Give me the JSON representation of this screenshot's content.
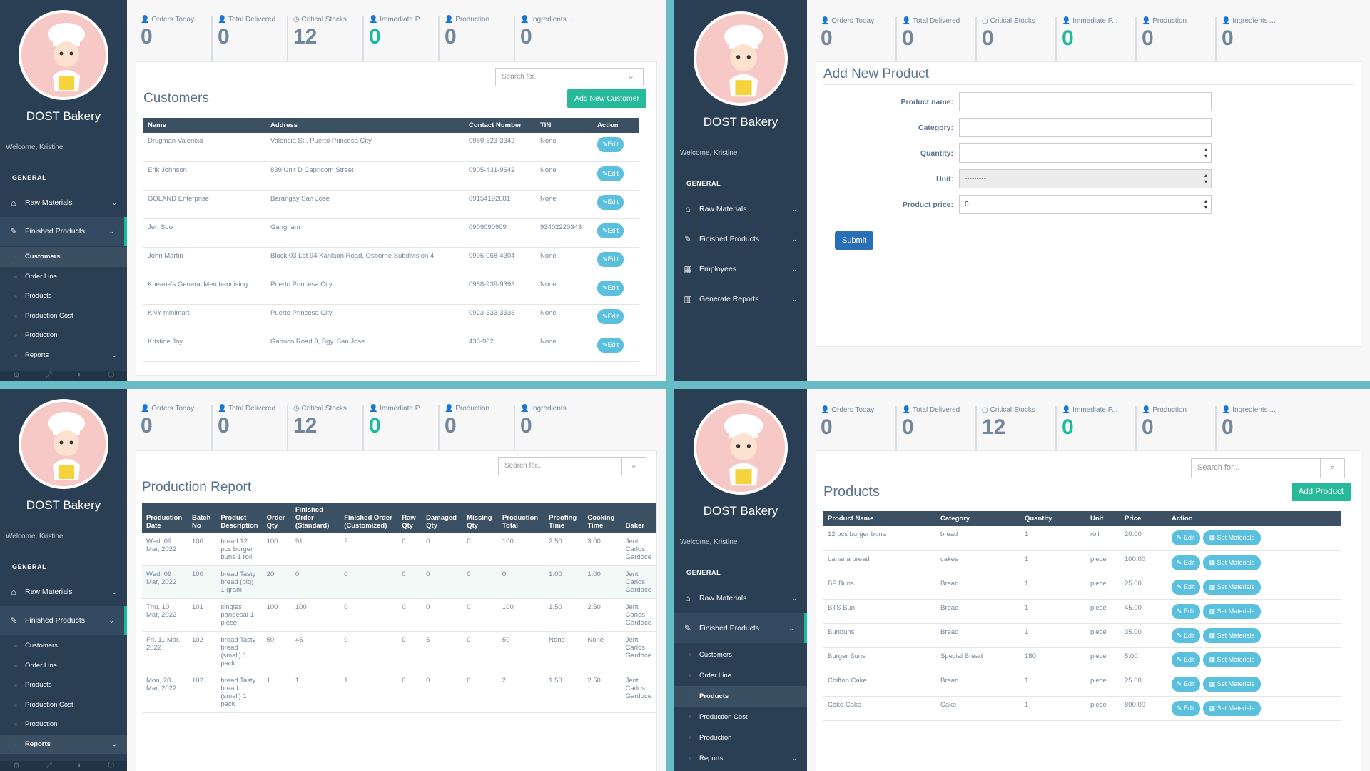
{
  "brand": {
    "name": "DOST Bakery",
    "welcome": "Welcome, Kristine"
  },
  "colors": {
    "sidebar": "#2a3f54",
    "accent_green": "#1abb9c",
    "button_info": "#5bc0de",
    "table_header": "#3c5063"
  },
  "tiles": [
    {
      "icon": "user-icon",
      "label": "Orders Today"
    },
    {
      "icon": "user-icon",
      "label": "Total Delivered"
    },
    {
      "icon": "clock-icon",
      "label": "Critical Stocks"
    },
    {
      "icon": "user-icon",
      "label": "Immediate P..."
    },
    {
      "icon": "user-icon",
      "label": "Production"
    },
    {
      "icon": "user-icon",
      "label": "Ingredients ..."
    }
  ],
  "tile_values_full": [
    "0",
    "0",
    "12",
    "0",
    "0",
    "0"
  ],
  "tile_values_form": [
    "0",
    "0",
    "0",
    "0",
    "0",
    "0"
  ],
  "nav": {
    "section": "GENERAL",
    "raw_materials": "Raw Materials",
    "finished_products": "Finished Products",
    "employees": "Employees",
    "generate_reports": "Generate Reports",
    "sub": [
      "Customers",
      "Order Line",
      "Products",
      "Production Cost",
      "Production",
      "Reports"
    ]
  },
  "search_placeholder": "Search for...",
  "customers": {
    "title": "Customers",
    "add_label": "Add New Customer",
    "edit_label": "Edit",
    "columns": [
      "Name",
      "Address",
      "Contact Number",
      "TIN",
      "Action"
    ],
    "rows": [
      {
        "name": "Drugman Valencia",
        "address": "Valencia St., Puerto Princesa City",
        "contact": "0989-323-3342",
        "tin": "None"
      },
      {
        "name": "Erik Johnson",
        "address": "839 Unit D Capricorn Street",
        "contact": "0905-431-9642",
        "tin": "None"
      },
      {
        "name": "GOLAND Enterprise",
        "address": "Barangay San Jose",
        "contact": "09154192681",
        "tin": "None"
      },
      {
        "name": "Jen Soo",
        "address": "Gangnam",
        "contact": "0909090909",
        "tin": "93402220343"
      },
      {
        "name": "John Martin",
        "address": "Block 03 Lot 94 Kanlaon Road, Osborne Subdivision 4",
        "contact": "0995-068-4304",
        "tin": "None"
      },
      {
        "name": "Kheane's General Merchandising",
        "address": "Puerto Princesa City",
        "contact": "0988-939-9393",
        "tin": "None"
      },
      {
        "name": "KNY minimart",
        "address": "Puerto Princesa City",
        "contact": "0923-333-3333",
        "tin": "None"
      },
      {
        "name": "Kristine Joy",
        "address": "Gabuco Road 3, Bgy. San Jose",
        "contact": "433-982",
        "tin": "None"
      }
    ]
  },
  "add_product": {
    "title": "Add New Product",
    "fields": {
      "product_name": "Product name:",
      "category": "Category:",
      "quantity": "Quantity:",
      "unit": "Unit:",
      "price": "Product price:"
    },
    "unit_value": "---------",
    "price_value": "0",
    "submit": "Submit"
  },
  "production_report": {
    "title": "Production Report",
    "columns": [
      "Production Date",
      "Batch No",
      "Product Description",
      "Order Qty",
      "Finished Order (Standard)",
      "Finished Order (Customized)",
      "Raw Qty",
      "Damaged Qty",
      "Missing Qty",
      "Production Total",
      "Proofing Time",
      "Cooking Time",
      "Baker"
    ],
    "rows": [
      [
        "Wed, 09 Mar, 2022",
        "100",
        "bread 12 pcs burger buns 1 roll",
        "100",
        "91",
        "9",
        "0",
        "0",
        "0",
        "100",
        "2.50",
        "3.00",
        "Jent Carlos Gardoce"
      ],
      [
        "Wed, 09 Mar, 2022",
        "100",
        "bread Tasty bread (big) 1 gram",
        "20",
        "0",
        "0",
        "0",
        "0",
        "0",
        "0",
        "1.00",
        "1.00",
        "Jent Carlos Gardoce"
      ],
      [
        "Thu, 10 Mar, 2022",
        "101",
        "singles pandesal 1 piece",
        "100",
        "100",
        "0",
        "0",
        "0",
        "0",
        "100",
        "1.50",
        "2.50",
        "Jent Carlos Gardoce"
      ],
      [
        "Fri, 11 Mar, 2022",
        "102",
        "bread Tasty bread (small) 1 pack",
        "50",
        "45",
        "0",
        "0",
        "5",
        "0",
        "50",
        "None",
        "None",
        "Jent Carlos Gardoce"
      ],
      [
        "Mon, 28 Mar, 2022",
        "102",
        "bread Tasty bread (small) 1 pack",
        "1",
        "1",
        "1",
        "0",
        "0",
        "0",
        "2",
        "1.50",
        "2.50",
        "Jent Carlos Gardoce"
      ]
    ]
  },
  "products": {
    "title": "Products",
    "add_label": "Add Product",
    "edit_label": "Edit",
    "set_label": "Set Materials",
    "columns": [
      "Product Name",
      "Category",
      "Quantity",
      "Unit",
      "Price",
      "Action"
    ],
    "rows": [
      [
        "12 pcs burger buns",
        "bread",
        "1",
        "roll",
        "20.00"
      ],
      [
        "banana bread",
        "cakes",
        "1",
        "piece",
        "100.00"
      ],
      [
        "BP Buns",
        "Bread",
        "1",
        "piece",
        "25.00"
      ],
      [
        "BTS Bun",
        "Bread",
        "1",
        "piece",
        "45.00"
      ],
      [
        "Bunbuns",
        "Bread",
        "1",
        "piece",
        "35.00"
      ],
      [
        "Burger Buns",
        "Special Bread",
        "180",
        "piece",
        "5.00"
      ],
      [
        "Chiffon Cake",
        "Bread",
        "1",
        "piece",
        "25.00"
      ],
      [
        "Coke Cake",
        "Cake",
        "1",
        "piece",
        "800.00"
      ]
    ]
  }
}
